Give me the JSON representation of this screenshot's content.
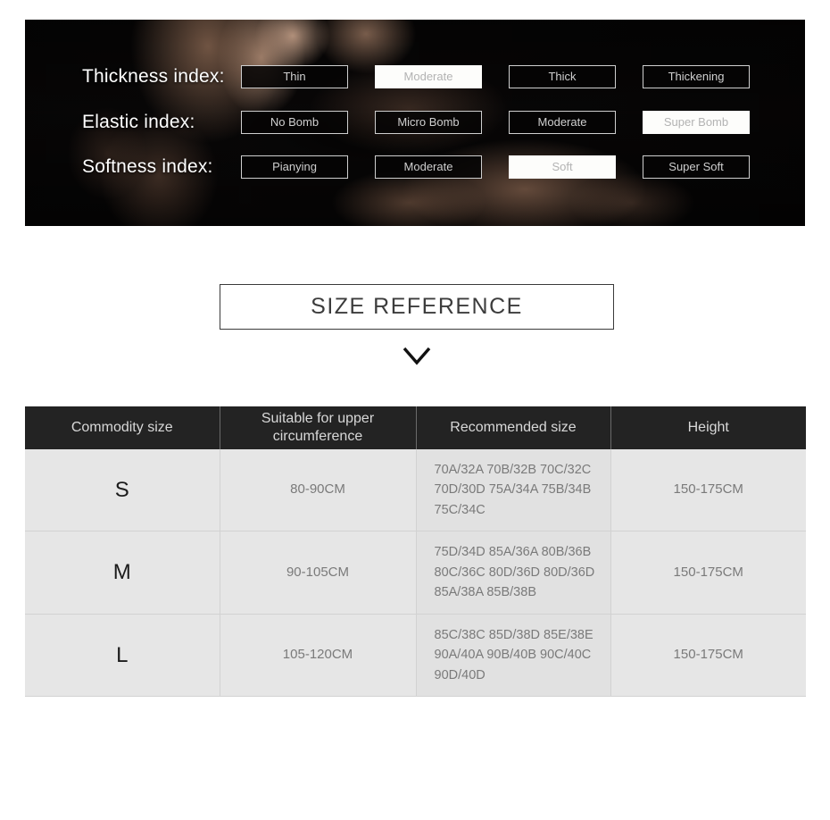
{
  "banner": {
    "rows": [
      {
        "label": "Thickness index:",
        "name": "thickness-index",
        "options": [
          {
            "label": "Thin",
            "active": false
          },
          {
            "label": "Moderate",
            "active": true
          },
          {
            "label": "Thick",
            "active": false
          },
          {
            "label": "Thickening",
            "active": false
          }
        ]
      },
      {
        "label": "Elastic index:",
        "name": "elastic-index",
        "options": [
          {
            "label": "No Bomb",
            "active": false
          },
          {
            "label": "Micro Bomb",
            "active": false
          },
          {
            "label": "Moderate",
            "active": false
          },
          {
            "label": "Super Bomb",
            "active": true
          }
        ]
      },
      {
        "label": "Softness index:",
        "name": "softness-index",
        "options": [
          {
            "label": "Pianying",
            "active": false
          },
          {
            "label": "Moderate",
            "active": false
          },
          {
            "label": "Soft",
            "active": true
          },
          {
            "label": "Super Soft",
            "active": false
          }
        ]
      }
    ]
  },
  "size_reference": {
    "title": "SIZE REFERENCE",
    "chevron_icon": "chevron-down-icon"
  },
  "table": {
    "headers": [
      "Commodity size",
      "Suitable for upper circumference",
      "Recommended size",
      "Height"
    ],
    "rows": [
      {
        "size": "S",
        "upper_circumference": "80-90CM",
        "recommended_size": "70A/32A 70B/32B 70C/32C 70D/30D 75A/34A 75B/34B 75C/34C",
        "height": "150-175CM"
      },
      {
        "size": "M",
        "upper_circumference": "90-105CM",
        "recommended_size": "75D/34D 85A/36A 80B/36B 80C/36C 80D/36D 80D/36D 85A/38A 85B/38B",
        "height": "150-175CM"
      },
      {
        "size": "L",
        "upper_circumference": "105-120CM",
        "recommended_size": "85C/38C 85D/38D 85E/38E 90A/40A 90B/40B 90C/40C 90D/40D",
        "height": "150-175CM"
      }
    ]
  },
  "colors": {
    "header_bg": "#232323",
    "row_bg": "#e6e6e6",
    "rec_cell_bg": "#e1e1e1",
    "active_btn_bg": "#fdfdfb",
    "btn_text": "#cfcfcf"
  }
}
